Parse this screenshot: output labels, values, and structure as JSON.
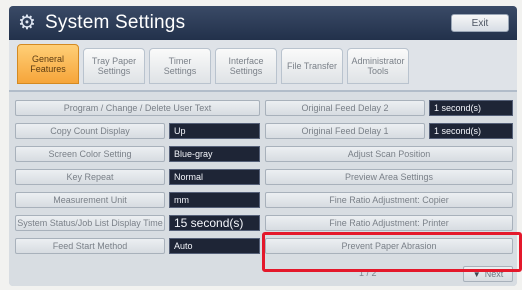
{
  "window": {
    "title": "System Settings",
    "exit_label": "Exit",
    "icon": "gear-icon"
  },
  "tabs": [
    {
      "label": "General Features",
      "active": true
    },
    {
      "label": "Tray Paper Settings",
      "active": false
    },
    {
      "label": "Timer Settings",
      "active": false
    },
    {
      "label": "Interface Settings",
      "active": false
    },
    {
      "label": "File Transfer",
      "active": false
    },
    {
      "label": "Administrator Tools",
      "active": false
    }
  ],
  "left_column": [
    {
      "label": "Program / Change / Delete User Text",
      "value": null
    },
    {
      "label": "Copy Count Display",
      "value": "Up"
    },
    {
      "label": "Screen Color Setting",
      "value": "Blue-gray"
    },
    {
      "label": "Key Repeat",
      "value": "Normal"
    },
    {
      "label": "Measurement Unit",
      "value": "mm"
    },
    {
      "label": "System Status/Job List Display Time",
      "value": "15 second(s)"
    },
    {
      "label": "Feed Start Method",
      "value": "Auto"
    }
  ],
  "right_column": [
    {
      "label": "Original Feed Delay 2",
      "value": "1 second(s)"
    },
    {
      "label": "Original Feed Delay 1",
      "value": "1 second(s)"
    },
    {
      "label": "Adjust Scan Position",
      "value": null
    },
    {
      "label": "Preview Area Settings",
      "value": null
    },
    {
      "label": "Fine Ratio Adjustment: Copier",
      "value": null
    },
    {
      "label": "Fine Ratio Adjustment: Printer",
      "value": null
    },
    {
      "label": "Prevent Paper Abrasion",
      "value": null
    }
  ],
  "pager": {
    "page_text": "1 / 2",
    "next_label": "Next"
  },
  "colors": {
    "highlight": "#e4182b",
    "active_tab": "#f6a53a",
    "titlebar": "#2b3a57"
  }
}
